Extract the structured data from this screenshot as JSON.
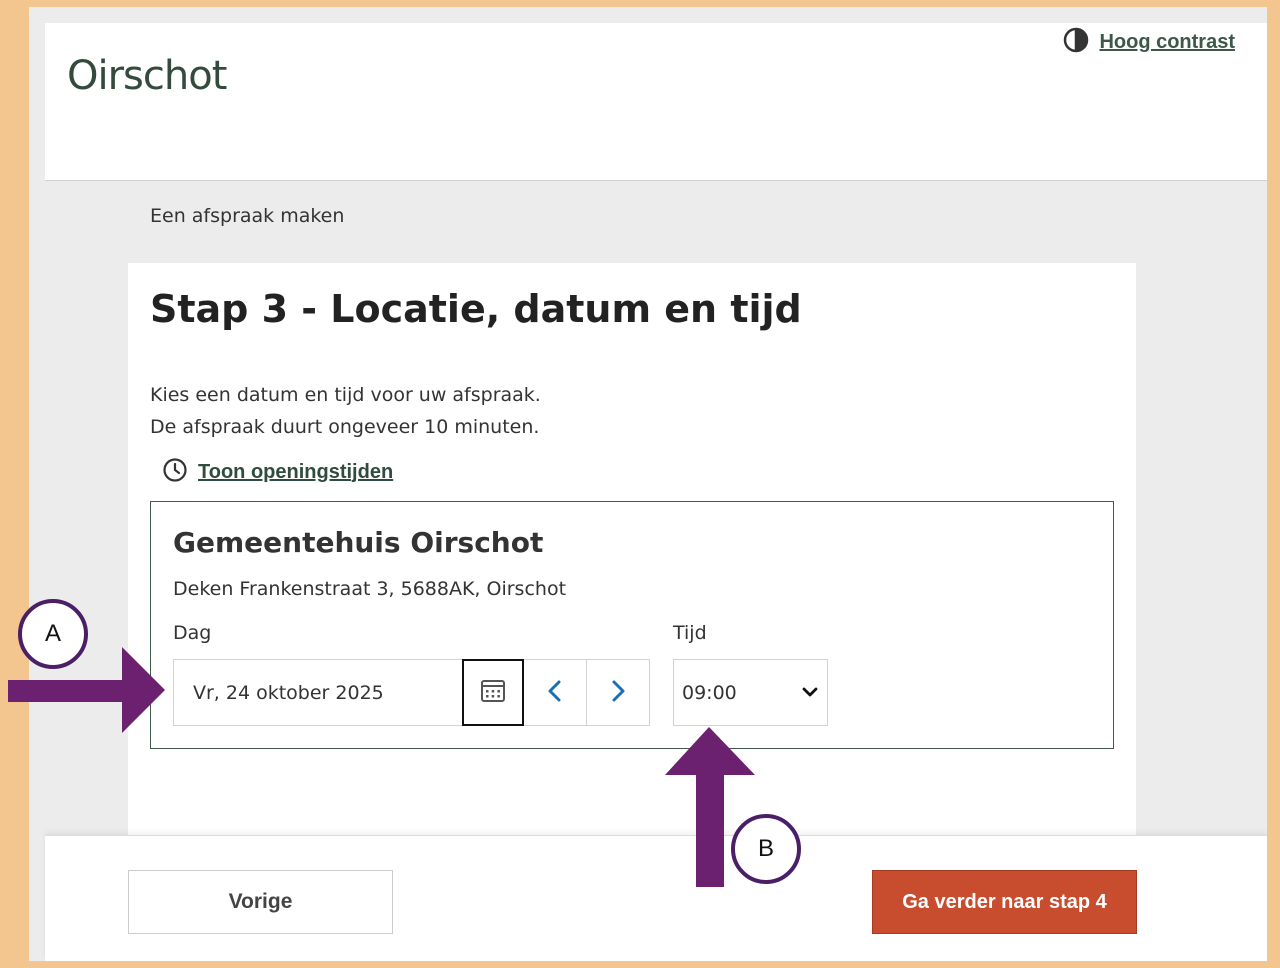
{
  "header": {
    "logo_text": "Oirschot",
    "contrast_link": "Hoog contrast"
  },
  "breadcrumb": "Een afspraak maken",
  "page": {
    "title": "Stap 3 - Locatie, datum en tijd",
    "intro_line1": "Kies een datum en tijd voor uw afspraak.",
    "intro_line2": "De afspraak duurt ongeveer 10 minuten.",
    "hours_link": "Toon openingstijden"
  },
  "location": {
    "name": "Gemeentehuis Oirschot",
    "address": "Deken Frankenstraat 3, 5688AK, Oirschot",
    "day_label": "Dag",
    "day_value": "Vr, 24 oktober 2025",
    "time_label": "Tijd",
    "time_value": "09:00"
  },
  "footer": {
    "prev_label": "Vorige",
    "next_label": "Ga verder naar stap 4"
  },
  "annotations": {
    "a_label": "A",
    "b_label": "B"
  },
  "colors": {
    "frame_border": "#f3c690",
    "brand_green": "#334b3c",
    "primary_button": "#c84c2e",
    "link_blue": "#1a6fb5",
    "arrow_purple": "#6b2170"
  },
  "icons": {
    "contrast": "half-circle-contrast-icon",
    "hours": "clock-icon",
    "calendar": "calendar-icon",
    "prev_day": "chevron-left-icon",
    "next_day": "chevron-right-icon",
    "time_dropdown": "chevron-down-icon"
  }
}
